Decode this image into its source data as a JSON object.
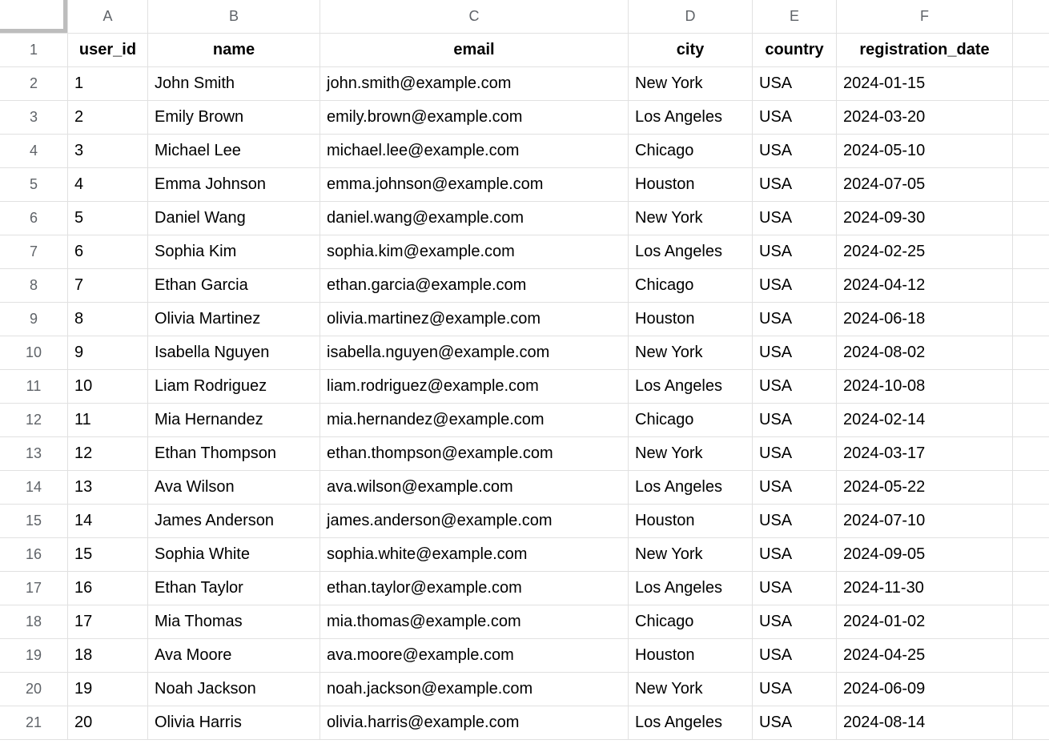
{
  "columns": [
    "A",
    "B",
    "C",
    "D",
    "E",
    "F"
  ],
  "row_numbers": [
    1,
    2,
    3,
    4,
    5,
    6,
    7,
    8,
    9,
    10,
    11,
    12,
    13,
    14,
    15,
    16,
    17,
    18,
    19,
    20,
    21
  ],
  "header_row": [
    "user_id",
    "name",
    "email",
    "city",
    "country",
    "registration_date"
  ],
  "rows": [
    [
      "1",
      "John Smith",
      "john.smith@example.com",
      "New York",
      "USA",
      "2024-01-15"
    ],
    [
      "2",
      "Emily Brown",
      "emily.brown@example.com",
      "Los Angeles",
      "USA",
      "2024-03-20"
    ],
    [
      "3",
      "Michael Lee",
      "michael.lee@example.com",
      "Chicago",
      "USA",
      "2024-05-10"
    ],
    [
      "4",
      "Emma Johnson",
      "emma.johnson@example.com",
      "Houston",
      "USA",
      "2024-07-05"
    ],
    [
      "5",
      "Daniel Wang",
      "daniel.wang@example.com",
      "New York",
      "USA",
      "2024-09-30"
    ],
    [
      "6",
      "Sophia Kim",
      "sophia.kim@example.com",
      "Los Angeles",
      "USA",
      "2024-02-25"
    ],
    [
      "7",
      "Ethan Garcia",
      "ethan.garcia@example.com",
      "Chicago",
      "USA",
      "2024-04-12"
    ],
    [
      "8",
      "Olivia Martinez",
      "olivia.martinez@example.com",
      "Houston",
      "USA",
      "2024-06-18"
    ],
    [
      "9",
      "Isabella Nguyen",
      "isabella.nguyen@example.com",
      "New York",
      "USA",
      "2024-08-02"
    ],
    [
      "10",
      "Liam Rodriguez",
      "liam.rodriguez@example.com",
      "Los Angeles",
      "USA",
      "2024-10-08"
    ],
    [
      "11",
      "Mia Hernandez",
      "mia.hernandez@example.com",
      "Chicago",
      "USA",
      "2024-02-14"
    ],
    [
      "12",
      "Ethan Thompson",
      "ethan.thompson@example.com",
      "New York",
      "USA",
      "2024-03-17"
    ],
    [
      "13",
      "Ava Wilson",
      "ava.wilson@example.com",
      "Los Angeles",
      "USA",
      "2024-05-22"
    ],
    [
      "14",
      "James Anderson",
      "james.anderson@example.com",
      "Houston",
      "USA",
      "2024-07-10"
    ],
    [
      "15",
      "Sophia White",
      "sophia.white@example.com",
      "New York",
      "USA",
      "2024-09-05"
    ],
    [
      "16",
      "Ethan Taylor",
      "ethan.taylor@example.com",
      "Los Angeles",
      "USA",
      "2024-11-30"
    ],
    [
      "17",
      "Mia Thomas",
      "mia.thomas@example.com",
      "Chicago",
      "USA",
      "2024-01-02"
    ],
    [
      "18",
      "Ava Moore",
      "ava.moore@example.com",
      "Houston",
      "USA",
      "2024-04-25"
    ],
    [
      "19",
      "Noah Jackson",
      "noah.jackson@example.com",
      "New York",
      "USA",
      "2024-06-09"
    ],
    [
      "20",
      "Olivia Harris",
      "olivia.harris@example.com",
      "Los Angeles",
      "USA",
      "2024-08-14"
    ]
  ]
}
